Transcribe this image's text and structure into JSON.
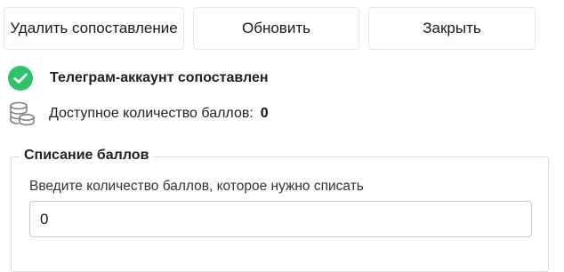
{
  "toolbar": {
    "unlink_label": "Удалить сопоставление",
    "refresh_label": "Обновить",
    "close_label": "Закрыть"
  },
  "status": {
    "text": "Телеграм-аккаунт сопоставлен",
    "icon": "check-circle-icon",
    "color": "#2ec26a"
  },
  "points": {
    "icon": "coins-icon",
    "label": "Доступное количество баллов:",
    "value": "0"
  },
  "writeoff": {
    "title": "Списание баллов",
    "field_label": "Введите количество баллов, которое нужно списать",
    "field_value": "0"
  }
}
